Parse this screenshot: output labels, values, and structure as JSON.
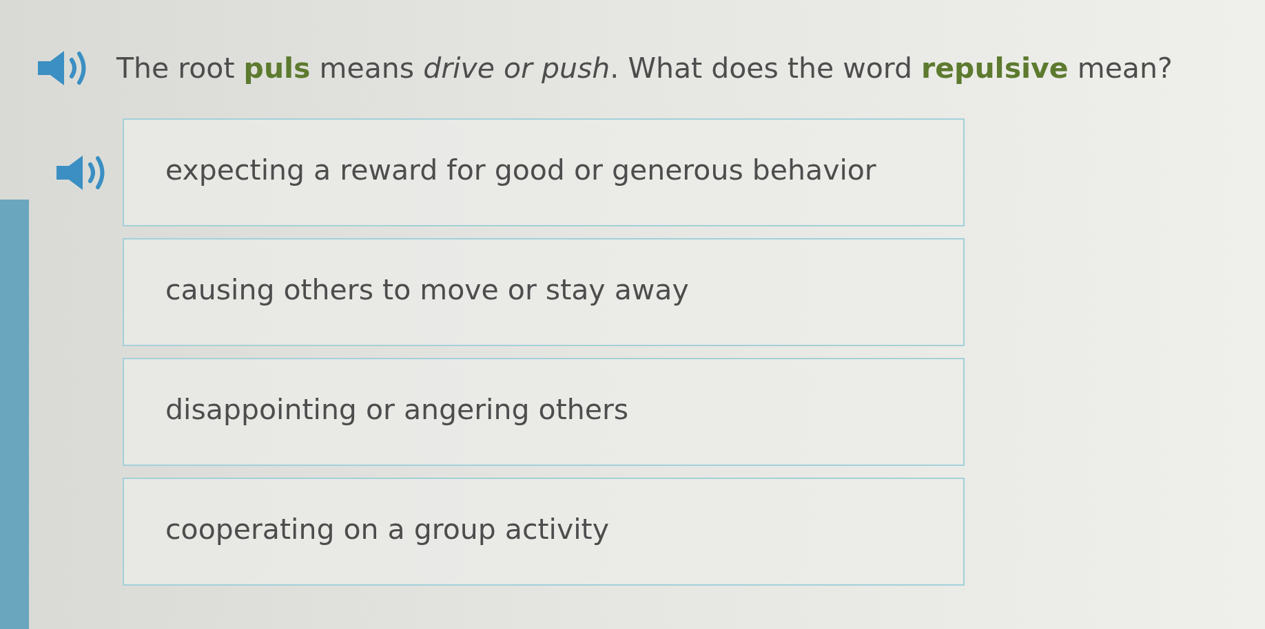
{
  "question": {
    "text": "The root **puls** means *drive or push*. What does the word **repulsive** mean?"
  },
  "options": [
    {
      "text": "expecting a reward for good or generous behavior",
      "speaker": true
    },
    {
      "text": "causing others to move or stay away",
      "speaker": false
    },
    {
      "text": "disappointing or angering others",
      "speaker": false
    },
    {
      "text": "cooperating on a group activity",
      "speaker": false
    }
  ]
}
